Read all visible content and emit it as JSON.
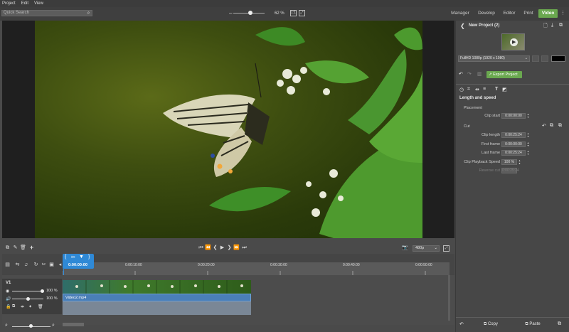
{
  "menu": [
    "Project",
    "Edit",
    "View"
  ],
  "search": {
    "placeholder": "Quick Search"
  },
  "zoom": {
    "value": "62 %",
    "level": 0.62
  },
  "view_tabs": [
    {
      "label": "Manager"
    },
    {
      "label": "Develop"
    },
    {
      "label": "Editor"
    },
    {
      "label": "Print"
    },
    {
      "label": "Video"
    }
  ],
  "right_panel": {
    "title": "New Project (2)",
    "format": "FullHD 1080p (1920 x 1080)",
    "export_label": "Export Project",
    "section_title": "Length and speed",
    "placement_heading": "Placement",
    "clip_start_label": "Clip start",
    "clip_start_value": "0:00:00:00",
    "cut_heading": "Cut",
    "clip_length_label": "Clip length",
    "clip_length_value": "0:00:25:24",
    "first_frame_label": "First frame",
    "first_frame_value": "0:00:00:00",
    "last_frame_label": "Last frame",
    "last_frame_value": "0:00:25:24",
    "speed_label": "Clip Playback Speed",
    "speed_value": "100 %",
    "reverse_label": "Reverse cut",
    "reverse_value": "0:00:25:24",
    "copy_label": "Copy",
    "paste_label": "Paste"
  },
  "timeline": {
    "playhead_time": "0:00:00:00",
    "quality": "480p",
    "ruler_labels": [
      "0:00:10:00",
      "0:00:20:00",
      "0:00:30:00",
      "0:00:40:00",
      "0:00:50:00"
    ],
    "track_name": "V1",
    "opacity_value": "100 %",
    "volume_value": "100 %",
    "clip_name": "Video2.mp4"
  },
  "colors": {
    "accent_green": "#6aa84f",
    "playhead_blue": "#2f89d6",
    "clip_blue": "#4a7fb8"
  }
}
